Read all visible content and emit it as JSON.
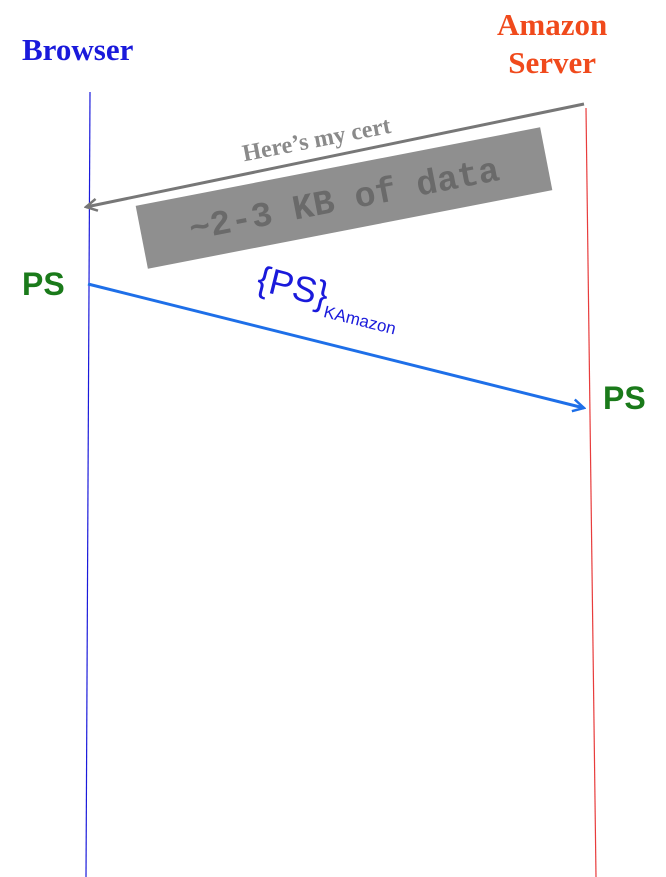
{
  "participants": {
    "browser": "Browser",
    "server_line1": "Amazon",
    "server_line2": "Server"
  },
  "messages": {
    "cert_label": "Here’s my cert",
    "cert_size": "~2-3 KB of data",
    "ps_message_main": "{PS}",
    "ps_message_sub": "KAmazon"
  },
  "secrets": {
    "browser_side": "PS",
    "server_side": "PS"
  },
  "colors": {
    "browser": "#1a1adb",
    "server": "#f04a1c",
    "cert_arrow": "#777777",
    "cert_box": "#8f8f8f",
    "ps_arrow": "#1e6fe8",
    "ps_text": "#1a7a1a"
  }
}
